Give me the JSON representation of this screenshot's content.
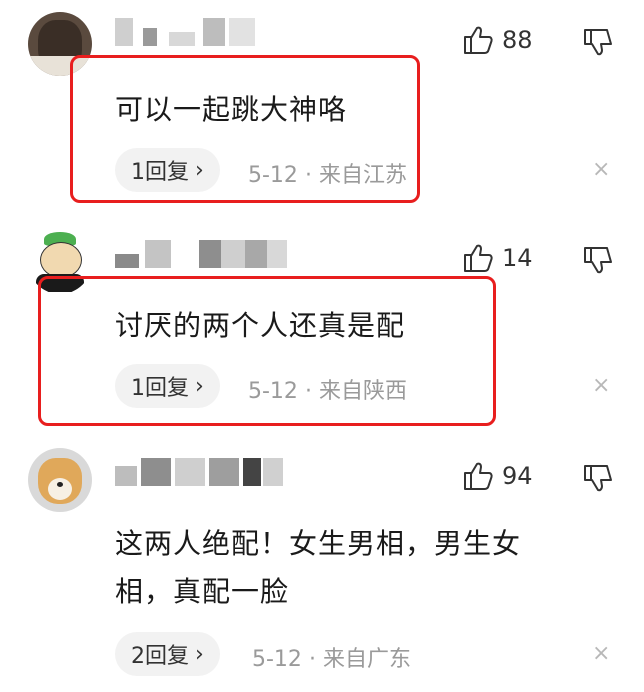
{
  "comments": [
    {
      "text_lines": [
        "可以一起跳大神咯"
      ],
      "likes": "88",
      "reply_count": "1回复",
      "date": "5-12",
      "location": "来自江苏",
      "highlighted": true
    },
    {
      "text_lines": [
        "讨厌的两个人还真是配"
      ],
      "likes": "14",
      "reply_count": "1回复",
      "date": "5-12",
      "location": "来自陕西",
      "highlighted": true
    },
    {
      "text_lines": [
        "这两人绝配！女生男相，男生女",
        "相，真配一脸"
      ],
      "likes": "94",
      "reply_count": "2回复",
      "date": "5-12",
      "location": "来自广东",
      "highlighted": false
    }
  ],
  "icons": {
    "like": "thumbs-up-icon",
    "dislike": "thumbs-down-icon",
    "close": "close-icon",
    "chevron": "chevron-right-icon"
  },
  "colors": {
    "highlight_border": "#e81e1e",
    "pill_bg": "#f2f2f2",
    "meta_text": "#9a9a9a"
  },
  "symbols": {
    "chevron": "›",
    "close": "×",
    "dot": "·"
  }
}
